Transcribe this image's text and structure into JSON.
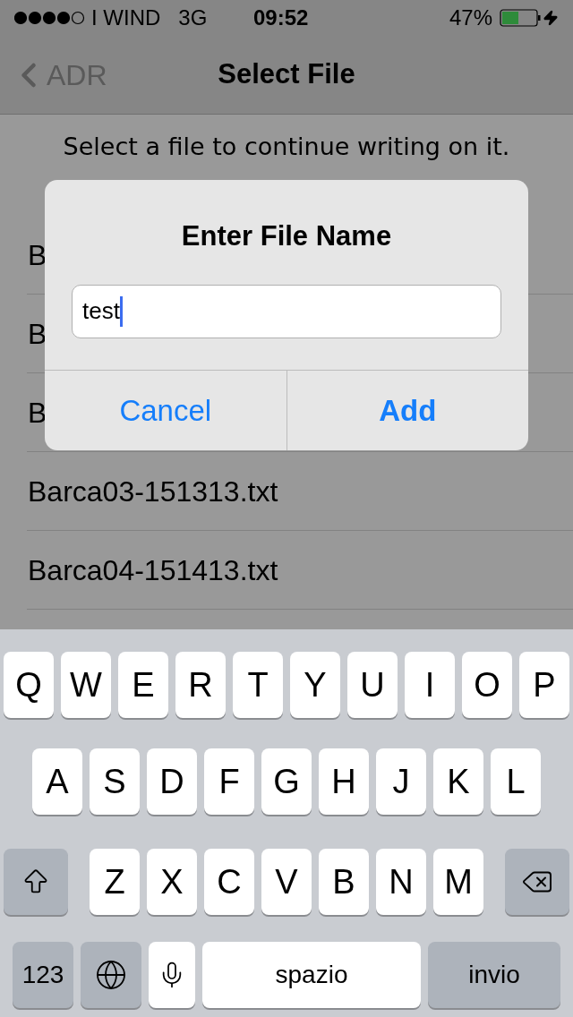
{
  "status_bar": {
    "carrier": "I WIND",
    "network": "3G",
    "time": "09:52",
    "battery": "47%"
  },
  "nav": {
    "back": "ADR",
    "title": "Select File"
  },
  "intro": [
    "Select a file to continue writing on it."
  ],
  "files": [
    "B",
    "B",
    "B",
    "Barca03-151313.txt",
    "Barca04-151413.txt"
  ],
  "dialog": {
    "title": "Enter File Name",
    "field": {
      "value": "test"
    },
    "buttons": [
      {
        "label": "Cancel",
        "kind": "cancel"
      },
      {
        "label": "Add",
        "kind": "default"
      }
    ]
  },
  "keyboard": {
    "top_letters": [
      {
        "kind": "letter",
        "label": "Q"
      },
      {
        "kind": "letter",
        "label": "W"
      },
      {
        "kind": "letter",
        "label": "E"
      },
      {
        "kind": "letter",
        "label": "R"
      },
      {
        "kind": "letter",
        "label": "T"
      },
      {
        "kind": "letter",
        "label": "Y"
      },
      {
        "kind": "letter",
        "label": "U"
      },
      {
        "kind": "letter",
        "label": "I"
      },
      {
        "kind": "letter",
        "label": "O"
      },
      {
        "kind": "letter",
        "label": "P"
      }
    ],
    "middle_letters": [
      {
        "kind": "letter",
        "label": "A"
      },
      {
        "kind": "letter",
        "label": "S"
      },
      {
        "kind": "letter",
        "label": "D"
      },
      {
        "kind": "letter",
        "label": "F"
      },
      {
        "kind": "letter",
        "label": "G"
      },
      {
        "kind": "letter",
        "label": "H"
      },
      {
        "kind": "letter",
        "label": "J"
      },
      {
        "kind": "letter",
        "label": "K"
      },
      {
        "kind": "letter",
        "label": "L"
      }
    ],
    "bottom_letters": [
      {
        "kind": "shift"
      },
      {
        "kind": "letter",
        "label": "Z"
      },
      {
        "kind": "letter",
        "label": "X"
      },
      {
        "kind": "letter",
        "label": "C"
      },
      {
        "kind": "letter",
        "label": "V"
      },
      {
        "kind": "letter",
        "label": "B"
      },
      {
        "kind": "letter",
        "label": "N"
      },
      {
        "kind": "letter",
        "label": "M"
      },
      {
        "kind": "delete"
      }
    ],
    "function_bar": [
      {
        "kind": "mode",
        "label": "123"
      },
      {
        "kind": "globe"
      },
      {
        "kind": "mic"
      },
      {
        "kind": "space",
        "label": "spazio"
      },
      {
        "kind": "return",
        "label": "invio"
      }
    ]
  }
}
